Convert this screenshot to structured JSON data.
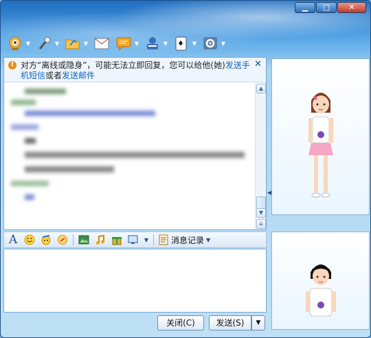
{
  "title_buttons": {
    "minimize": "▁",
    "maximize": "□",
    "close": "✕"
  },
  "toolbar": {
    "items": [
      {
        "name": "video",
        "icon": "webcam-icon"
      },
      {
        "name": "voice",
        "icon": "microphone-icon"
      },
      {
        "name": "file",
        "icon": "folder-icon"
      },
      {
        "name": "email",
        "icon": "mail-icon"
      },
      {
        "name": "sms",
        "icon": "message-icon"
      },
      {
        "name": "contact",
        "icon": "contact-card-icon"
      },
      {
        "name": "game",
        "icon": "cards-icon"
      },
      {
        "name": "settings",
        "icon": "gear-icon"
      }
    ]
  },
  "notice": {
    "text_before": "对方“离线或隐身”，可能无法立即回复，您可以给他(她)",
    "link_sms": "发送手机短信",
    "text_or": "或者",
    "link_email": "发送邮件",
    "close": "✕"
  },
  "format_toolbar": {
    "font_icon": "A",
    "history_label": "消息记录"
  },
  "buttons": {
    "close_label": "关闭(C)",
    "send_label": "发送(S)",
    "send_menu": "▼"
  },
  "colors": {
    "accent": "#2f7fcf",
    "link": "#0a64c4"
  }
}
